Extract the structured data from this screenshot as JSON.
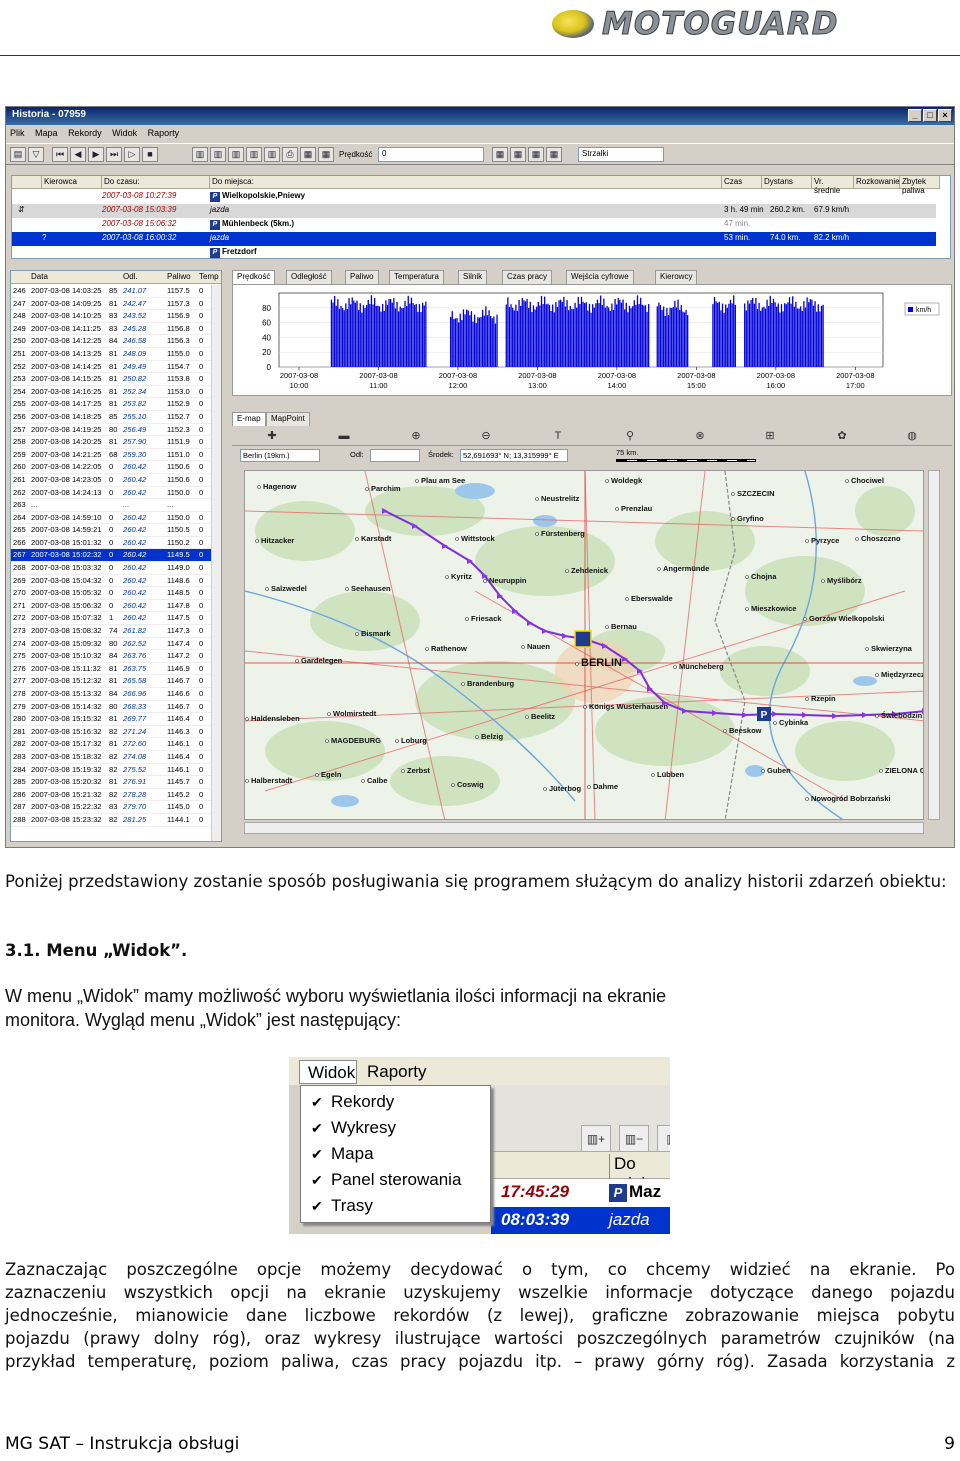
{
  "header": {
    "logo_text": "MOTOGUARD"
  },
  "app": {
    "title": "Historia - 07959",
    "menu": [
      "Plik",
      "Mapa",
      "Rekordy",
      "Widok",
      "Raporty"
    ],
    "toolbar": {
      "priority_label": "Prędkość",
      "priority_value": "0",
      "arrow_select": "Strzałki"
    },
    "history": {
      "headers": [
        "Kierowca",
        "Do czasu:",
        "Do miejsca:",
        "Czas",
        "Dystans",
        "Vr. średnie",
        "Rozkowanie",
        "Zbytek paliwa"
      ],
      "rows": [
        {
          "kierowca": "",
          "czas": "2007-03-08 10:27:39",
          "miejsce": "Wielkopolskie,Pniewy",
          "p": true,
          "dur": "",
          "dist": "",
          "vavg": ""
        },
        {
          "kierowca": "",
          "czas": "2007-03-08 15:03:39",
          "miejsce": "jazda",
          "p": false,
          "dur": "3 h. 49 min",
          "dist": "260.2 km.",
          "vavg": "67.9 km/h"
        },
        {
          "kierowca": "",
          "czas": "2007-03-08 15:06:32",
          "miejsce": "Mühlenbeck (5km.)",
          "p": true,
          "dur": "47 min.",
          "dist": "",
          "vavg": ""
        },
        {
          "kierowca": "?",
          "czas": "2007-03-08 16:00:32",
          "miejsce": "jazda",
          "p": false,
          "dur": "53 min.",
          "dist": "74.0 km.",
          "vavg": "82.2 km/h",
          "selected": true
        },
        {
          "kierowca": "",
          "czas": "",
          "miejsce": "Fretzdorf",
          "p": true,
          "dur": "",
          "dist": "",
          "vavg": ""
        }
      ]
    },
    "records": {
      "headers": [
        "Data",
        "Odl.",
        "Paliwo",
        "Temp"
      ],
      "rows": [
        [
          "246",
          "2007-03-08 14:03:25",
          "85",
          "241.07",
          "1157.5",
          "0"
        ],
        [
          "247",
          "2007-03-08 14:09:25",
          "81",
          "242.47",
          "1157.3",
          "0"
        ],
        [
          "248",
          "2007-03-08 14:10:25",
          "83",
          "243.52",
          "1156.9",
          "0"
        ],
        [
          "249",
          "2007-03-08 14:11:25",
          "83",
          "245.28",
          "1156.8",
          "0"
        ],
        [
          "250",
          "2007-03-08 14:12:25",
          "84",
          "246.58",
          "1156.3",
          "0"
        ],
        [
          "251",
          "2007-03-08 14:13:25",
          "81",
          "248.09",
          "1155.0",
          "0"
        ],
        [
          "252",
          "2007-03-08 14:14:25",
          "81",
          "249.49",
          "1154.7",
          "0"
        ],
        [
          "253",
          "2007-03-08 14:15:25",
          "81",
          "250.82",
          "1153.8",
          "0"
        ],
        [
          "254",
          "2007-03-08 14:16:25",
          "81",
          "252.34",
          "1153.0",
          "0"
        ],
        [
          "255",
          "2007-03-08 14:17:25",
          "81",
          "253.82",
          "1152.9",
          "0"
        ],
        [
          "256",
          "2007-03-08 14:18:25",
          "85",
          "255.10",
          "1152.7",
          "0"
        ],
        [
          "257",
          "2007-03-08 14:19:25",
          "80",
          "256.49",
          "1152.3",
          "0"
        ],
        [
          "258",
          "2007-03-08 14:20:25",
          "81",
          "257.90",
          "1151.9",
          "0"
        ],
        [
          "259",
          "2007-03-08 14:21:25",
          "68",
          "259.30",
          "1151.0",
          "0"
        ],
        [
          "260",
          "2007-03-08 14:22:05",
          "0",
          "260.42",
          "1150.6",
          "0"
        ],
        [
          "261",
          "2007-03-08 14:23:05",
          "0",
          "260.42",
          "1150.6",
          "0"
        ],
        [
          "262",
          "2007-03-08 14:24:13",
          "0",
          "260.42",
          "1150.0",
          "0"
        ],
        [
          "263",
          "...",
          "",
          "...",
          "...",
          ""
        ],
        [
          "264",
          "2007-03-08 14:59:10",
          "0",
          "260.42",
          "1150.0",
          "0"
        ],
        [
          "265",
          "2007-03-08 14:59:21",
          "0",
          "260.42",
          "1150.5",
          "0"
        ],
        [
          "266",
          "2007-03-08 15:01:32",
          "0",
          "260.42",
          "1150.2",
          "0"
        ],
        [
          "267",
          "2007-03-08 15:02:32",
          "0",
          "260.42",
          "1149.5",
          "0"
        ],
        [
          "268",
          "2007-03-08 15:03:32",
          "0",
          "260.42",
          "1149.0",
          "0"
        ],
        [
          "269",
          "2007-03-08 15:04:32",
          "0",
          "260.42",
          "1148.6",
          "0"
        ],
        [
          "270",
          "2007-03-08 15:05:32",
          "0",
          "260.42",
          "1148.5",
          "0"
        ],
        [
          "271",
          "2007-03-08 15:06:32",
          "0",
          "260.42",
          "1147.8",
          "0"
        ],
        [
          "272",
          "2007-03-08 15:07:32",
          "1",
          "260.42",
          "1147.5",
          "0"
        ],
        [
          "273",
          "2007-03-08 15:08:32",
          "74",
          "261.82",
          "1147.3",
          "0"
        ],
        [
          "274",
          "2007-03-08 15:09:32",
          "80",
          "262.52",
          "1147.4",
          "0"
        ],
        [
          "275",
          "2007-03-08 15:10:32",
          "84",
          "263.76",
          "1147.2",
          "0"
        ],
        [
          "276",
          "2007-03-08 15:11:32",
          "81",
          "263.75",
          "1146.9",
          "0"
        ],
        [
          "277",
          "2007-03-08 15:12:32",
          "81",
          "265.58",
          "1146.7",
          "0"
        ],
        [
          "278",
          "2007-03-08 15:13:32",
          "84",
          "266.96",
          "1146.6",
          "0"
        ],
        [
          "279",
          "2007-03-08 15:14:32",
          "80",
          "268.33",
          "1146.7",
          "0"
        ],
        [
          "280",
          "2007-03-08 15:15:32",
          "81",
          "269.77",
          "1146.4",
          "0"
        ],
        [
          "281",
          "2007-03-08 15:16:32",
          "82",
          "271.24",
          "1146.3",
          "0"
        ],
        [
          "282",
          "2007-03-08 15:17:32",
          "81",
          "272.60",
          "1146.1",
          "0"
        ],
        [
          "283",
          "2007-03-08 15:18:32",
          "82",
          "274.08",
          "1146.4",
          "0"
        ],
        [
          "284",
          "2007-03-08 15:19:32",
          "82",
          "275.52",
          "1146.1",
          "0"
        ],
        [
          "285",
          "2007-03-08 15:20:32",
          "81",
          "276.91",
          "1145.7",
          "0"
        ],
        [
          "286",
          "2007-03-08 15:21:32",
          "82",
          "278.28",
          "1145.2",
          "0"
        ],
        [
          "287",
          "2007-03-08 15:22:32",
          "83",
          "279.70",
          "1145.0",
          "0"
        ],
        [
          "288",
          "2007-03-08 15:23:32",
          "82",
          "281.25",
          "1144.1",
          "0"
        ]
      ],
      "selected_index": 21
    },
    "chart_tabs": [
      "Prędkość",
      "Odległość",
      "Paliwo",
      "Temperatura",
      "Silnik",
      "Czas pracy",
      "Wejścia cyfrowe",
      "Kierowcy"
    ],
    "chart_legend": "km/h",
    "map_tabs": [
      "E-map",
      "MapPoint"
    ],
    "map_fields": {
      "city": "Berlin (19km.)",
      "odl_label": "Odl:",
      "srodek_label": "Środek:",
      "srodek_value": "52,691693° N; 13,315999° E",
      "scale": "75 km."
    },
    "map_cities": [
      "Hagenow",
      "Parchim",
      "Plau am See",
      "Woldegk",
      "SZCZECIN",
      "Chociwel",
      "Neustrelitz",
      "Prenzlau",
      "Gryfino",
      "Hitzacker",
      "Karstadt",
      "Wittstock",
      "Fürstenberg",
      "Pyrzyce",
      "Choszczno",
      "Salzwedel",
      "Kyritz",
      "Neuruppin",
      "Zehdenick",
      "Angermünde",
      "Chojna",
      "Myślibórz",
      "Seehausen",
      "Eberswalde",
      "Mieszkowice",
      "Friesack",
      "Bernau",
      "Gorzów Wielkopolski",
      "Bismark",
      "Rathenow",
      "Nauen",
      "BERLIN",
      "Skwierzyna",
      "Gardelegen",
      "Müncheberg",
      "Brandenburg",
      "Międzyrzecz",
      "Rzepin",
      "Haldensleben",
      "Wolmirstedt",
      "Beelitz",
      "Königs Wusterhausen",
      "Cybinka",
      "Świebodzin",
      "MAGDEBURG",
      "Loburg",
      "Belzig",
      "Beeskow",
      "Jüterbog",
      "Guben",
      "Egeln",
      "Zerbst",
      "Lübben",
      "ZIELONA GÓRA",
      "Halberstadt",
      "Calbe",
      "Coswig",
      "Dahme",
      "Nowogród Bobrzański"
    ]
  },
  "chart_data": {
    "type": "bar",
    "title": "",
    "xlabel": "",
    "ylabel": "",
    "ylim": [
      0,
      100
    ],
    "yticks": [
      0,
      20,
      40,
      60,
      80
    ],
    "xticks": [
      "2007-03-08\n10:00",
      "2007-03-08\n11:00",
      "2007-03-08\n12:00",
      "2007-03-08\n13:00",
      "2007-03-08\n14:00",
      "2007-03-08\n15:00",
      "2007-03-08\n16:00",
      "2007-03-08\n17:00"
    ],
    "series": [
      {
        "name": "km/h",
        "segments": [
          {
            "from": 0.4,
            "to": 1.6,
            "value": 85
          },
          {
            "from": 1.9,
            "to": 2.5,
            "value": 70
          },
          {
            "from": 2.6,
            "to": 4.4,
            "value": 85
          },
          {
            "from": 4.5,
            "to": 4.9,
            "value": 80
          },
          {
            "from": 5.2,
            "to": 5.5,
            "value": 85
          },
          {
            "from": 5.6,
            "to": 6.6,
            "value": 85
          }
        ]
      }
    ]
  },
  "body": {
    "intro": "Poniżej przedstawiony zostanie sposób posługiwania się programem służącym do analizy historii zdarzeń obiektu:",
    "section_title": "3.1. Menu „Widok”.",
    "menu_desc_1": "W menu „Widok” mamy możliwość wyboru wyświetlania ilości informacji na ekranie",
    "menu_desc_2": "monitora. Wygląd menu „Widok” jest następujący:",
    "para_lines": [
      "Zaznaczając poszczególne opcje możemy decydować o tym, co chcemy widzieć na ekranie. Po",
      "zaznaczeniu wszystkich opcji na ekranie uzyskujemy wszelkie informacje dotyczące danego pojazdu",
      "jednocześnie, mianowicie dane liczbowe rekordów (z lewej), graficzne zobrazowanie miejsca pobytu",
      "pojazdu (prawy dolny róg), oraz wykresy ilustrujące wartości poszczególnych parametrów czujników (na",
      "przykład temperaturę, poziom paliwa, czas pracy pojazdu itp. – prawy górny róg). Zasada korzystania z"
    ]
  },
  "menu_shot": {
    "menu_widok": "Widok",
    "menu_raporty": "Raporty",
    "items": [
      "Rekordy",
      "Wykresy",
      "Mapa",
      "Panel sterowania",
      "Trasy"
    ],
    "col_header": "Do miejs",
    "row1_time": "17:45:29",
    "row1_place": "Maz",
    "row2_time": "08:03:39",
    "row2_place": "jazda"
  },
  "footer": {
    "left": "MG SAT – Instrukcja obsługi",
    "page": "9"
  }
}
